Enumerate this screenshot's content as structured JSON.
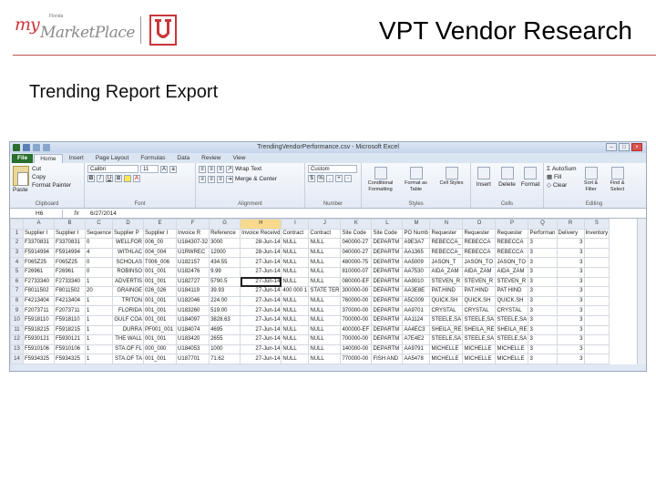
{
  "slide": {
    "title": "VPT Vendor Research",
    "subtitle": "Trending Report Export"
  },
  "logo": {
    "my": "my",
    "florida": "Florida",
    "marketplace": "MarketPlace"
  },
  "colors": {
    "title_rule": "#c0504d",
    "logo_red": "#c9353a",
    "excel_file_tab": "#2a6f2d"
  },
  "excel": {
    "window_title": "TrendingVendorPerformance.csv - Microsoft Excel",
    "tabs": [
      "File",
      "Home",
      "Insert",
      "Page Layout",
      "Formulas",
      "Data",
      "Review",
      "View"
    ],
    "active_tab": "Home",
    "ribbon": {
      "clipboard": {
        "paste": "Paste",
        "cut": "Cut",
        "copy": "Copy",
        "format_painter": "Format Painter",
        "label": "Clipboard"
      },
      "font": {
        "name": "Calibri",
        "size": "11",
        "label": "Font"
      },
      "alignment": {
        "wrap": "Wrap Text",
        "merge": "Merge & Center",
        "label": "Alignment"
      },
      "number": {
        "format": "Custom",
        "label": "Number"
      },
      "styles": {
        "conditional": "Conditional Formatting",
        "format_table": "Format as Table",
        "cell_styles": "Cell Styles",
        "label": "Styles"
      },
      "cells": {
        "insert": "Insert",
        "delete": "Delete",
        "format": "Format",
        "label": "Cells"
      },
      "editing": {
        "autosum": "AutoSum",
        "fill": "Fill",
        "clear": "Clear",
        "sort": "Sort & Filter",
        "find": "Find & Select",
        "label": "Editing"
      }
    },
    "name_box": "H6",
    "formula_value": "6/27/2014",
    "columns": [
      "A",
      "B",
      "C",
      "D",
      "E",
      "F",
      "G",
      "H",
      "I",
      "J",
      "K",
      "L",
      "M",
      "N",
      "O",
      "P",
      "Q",
      "R",
      "S"
    ],
    "selected_column": "H",
    "rows": [
      [
        "1",
        "Supplier I",
        "Supplier I",
        "Sequence",
        "Supplier P",
        "Supplier I",
        "Invoice R",
        "Reference",
        "Invoice Receivd",
        "Contract",
        "Contract",
        "Site Code",
        "Site Code",
        "PO Numb",
        "Requester",
        "Requester",
        "Requester",
        "Performan",
        "Delivery",
        "Inventory"
      ],
      [
        "2",
        "F3370831",
        "F3370831",
        "0",
        "WELLFOR",
        "006_00",
        "U184307-32",
        "3000",
        "28-Jun-14",
        "NULL",
        "NULL",
        "040000-27",
        "DEPARTM",
        "A9E3A7",
        "REBECCA_",
        "REBECCA",
        "REBECCA",
        "3",
        "3",
        ""
      ],
      [
        "3",
        "F5914994",
        "F5914994",
        "4",
        "WITHLAC",
        "004_004",
        "U1RWREC",
        "12000",
        "28-Jun-14",
        "NULL",
        "NULL",
        "040000-27",
        "DEPARTM",
        "AA1365",
        "REBECCA_",
        "REBECCA",
        "REBECCA",
        "3",
        "3",
        ""
      ],
      [
        "4",
        "F065Z25",
        "F065Z25",
        "0",
        "SCHOLAS",
        "T006_006",
        "U182157",
        "434.55",
        "27-Jun-14",
        "NULL",
        "NULL",
        "480000-75",
        "DEPARTM",
        "AA5009",
        "JASON_T",
        "JASON_TO",
        "JASON_TO",
        "3",
        "3",
        ""
      ],
      [
        "5",
        "F26961",
        "F26961",
        "0",
        "ROBINSO",
        "001_001",
        "U182476",
        "9.99",
        "27-Jun-14",
        "NULL",
        "NULL",
        "810000-07",
        "DEPARTM",
        "AA7530",
        "AIDA_ZAM",
        "AIDA_ZAM",
        "AIDA_ZAM",
        "3",
        "3",
        ""
      ],
      [
        "6",
        "F2733340",
        "F2733340",
        "1",
        "ADVERTIS",
        "001_001",
        "U182727",
        "5790.5",
        "27-Jun-14",
        "NULL",
        "NULL",
        "080000-EF",
        "DEPARTM",
        "AA9010",
        "STEVEN_R",
        "STEVEN_R",
        "STEVEN_R",
        "3",
        "3",
        ""
      ],
      [
        "7",
        "F8011502",
        "F8011502",
        "20",
        "GRAINGE",
        "026_026",
        "U184119",
        "39.93",
        "27-Jun-14",
        "400 000 1",
        "STATE TER",
        "300000-00",
        "DEPARTM",
        "AA3E8E",
        "PAT.HIND",
        "PAT.HIND",
        "PAT HIND",
        "3",
        "3",
        ""
      ],
      [
        "8",
        "F4213404",
        "F4213404",
        "1",
        "TRITON",
        "001_001",
        "U182046",
        "224.00",
        "27-Jun-14",
        "NULL",
        "NULL",
        "760000-00",
        "DEPARTM",
        "A5C009",
        "QUICK.SH",
        "QUICK.SH",
        "QUICK.SH",
        "3",
        "3",
        ""
      ],
      [
        "9",
        "F2073711",
        "F2073711",
        "1",
        "FLORIDA",
        "001_001",
        "U183260",
        "519.00",
        "27-Jun-14",
        "NULL",
        "NULL",
        "370000-00",
        "DEPARTM",
        "AA9701",
        "CRYSTAL",
        "CRYSTAL",
        "CRYSTAL",
        "3",
        "3",
        ""
      ],
      [
        "10",
        "F5918110",
        "F5918110",
        "1",
        "GULF COA",
        "001_001",
        "U184097",
        "3828.63",
        "27-Jun-14",
        "NULL",
        "NULL",
        "700000-00",
        "DEPARTM",
        "AA1124",
        "STEELE,SA",
        "STEELE,SA",
        "STEELE,SA",
        "3",
        "3",
        ""
      ],
      [
        "11",
        "F5918215",
        "F5918215",
        "1",
        "DURRA",
        "PF001_001",
        "U184074",
        "4695",
        "27-Jun-14",
        "NULL",
        "NULL",
        "400000-EF",
        "DEPARTM",
        "AA4EC3",
        "SHEILA_RE",
        "SHEILA_RE",
        "SHEILA_RE",
        "3",
        "3",
        ""
      ],
      [
        "12",
        "F5930121",
        "F5930121",
        "1",
        "THE WALL",
        "001_001",
        "U183420",
        "2655",
        "27-Jun-14",
        "NULL",
        "NULL",
        "700000-00",
        "DEPARTM",
        "A7E4E2",
        "STEELE,SA",
        "STEELE,SA",
        "STEELE,SA",
        "3",
        "3",
        ""
      ],
      [
        "13",
        "F5910106",
        "F5910106",
        "1",
        "STA.OF FL",
        "000_000",
        "U184053",
        "1000",
        "27-Jun-14",
        "NULL",
        "NULL",
        "140000-00",
        "DEPARTM",
        "AA9791",
        "MICHELLE",
        "MICHELLE",
        "MICHELLE",
        "3",
        "3",
        ""
      ],
      [
        "14",
        "F5934325",
        "F5934325",
        "1",
        "STA.OF TA",
        "001_001",
        "U187701",
        "71.62",
        "27-Jun-14",
        "NULL",
        "NULL",
        "770000-00",
        "FISH AND",
        "AA5478",
        "MICHELLE",
        "MICHELLE",
        "MICHELLE",
        "3",
        "3",
        ""
      ]
    ]
  }
}
